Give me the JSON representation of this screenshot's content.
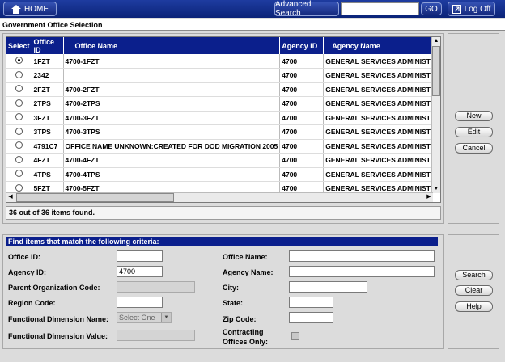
{
  "topbar": {
    "home_label": "HOME",
    "advanced_search_label": "Advanced Search",
    "search_value": "",
    "go_label": "GO",
    "logoff_label": "Log Off"
  },
  "page_title": "Government Office Selection",
  "grid": {
    "columns": [
      "Select",
      "Office ID",
      "Office Name",
      "Agency ID",
      "Agency Name"
    ],
    "rows": [
      {
        "selected": true,
        "office_id": "1FZT",
        "office_name": "4700-1FZT",
        "agency_id": "4700",
        "agency_name": "GENERAL SERVICES ADMINIST"
      },
      {
        "selected": false,
        "office_id": "2342",
        "office_name": "",
        "agency_id": "4700",
        "agency_name": "GENERAL SERVICES ADMINIST"
      },
      {
        "selected": false,
        "office_id": "2FZT",
        "office_name": "4700-2FZT",
        "agency_id": "4700",
        "agency_name": "GENERAL SERVICES ADMINIST"
      },
      {
        "selected": false,
        "office_id": "2TPS",
        "office_name": "4700-2TPS",
        "agency_id": "4700",
        "agency_name": "GENERAL SERVICES ADMINIST"
      },
      {
        "selected": false,
        "office_id": "3FZT",
        "office_name": "4700-3FZT",
        "agency_id": "4700",
        "agency_name": "GENERAL SERVICES ADMINIST"
      },
      {
        "selected": false,
        "office_id": "3TPS",
        "office_name": "4700-3TPS",
        "agency_id": "4700",
        "agency_name": "GENERAL SERVICES ADMINIST"
      },
      {
        "selected": false,
        "office_id": "4791C7",
        "office_name": "OFFICE NAME UNKNOWN:CREATED FOR DOD MIGRATION 2005",
        "agency_id": "4700",
        "agency_name": "GENERAL SERVICES ADMINIST"
      },
      {
        "selected": false,
        "office_id": "4FZT",
        "office_name": "4700-4FZT",
        "agency_id": "4700",
        "agency_name": "GENERAL SERVICES ADMINIST"
      },
      {
        "selected": false,
        "office_id": "4TPS",
        "office_name": "4700-4TPS",
        "agency_id": "4700",
        "agency_name": "GENERAL SERVICES ADMINIST"
      },
      {
        "selected": false,
        "office_id": "5FZT",
        "office_name": "4700-5FZT",
        "agency_id": "4700",
        "agency_name": "GENERAL SERVICES ADMINIST"
      }
    ],
    "count_text": "36 out of 36 items found."
  },
  "grid_actions": {
    "new_label": "New",
    "edit_label": "Edit",
    "cancel_label": "Cancel"
  },
  "criteria": {
    "heading": "Find items that match the following criteria:",
    "office_id_label": "Office ID:",
    "office_id_value": "",
    "agency_id_label": "Agency ID:",
    "agency_id_value": "4700",
    "parent_org_label": "Parent Organization Code:",
    "region_code_label": "Region Code:",
    "func_dim_name_label": "Functional Dimension Name:",
    "func_dim_name_value": "Select One",
    "func_dim_value_label": "Functional Dimension Value:",
    "office_name_label": "Office Name:",
    "agency_name_label": "Agency Name:",
    "city_label": "City:",
    "state_label": "State:",
    "zip_label": "Zip Code:",
    "contracting_label_1": "Contracting",
    "contracting_label_2": "Offices Only:"
  },
  "criteria_actions": {
    "search_label": "Search",
    "clear_label": "Clear",
    "help_label": "Help"
  },
  "colors": {
    "header_blue": "#0b1f8c",
    "topbar_blue": "#14287c"
  }
}
